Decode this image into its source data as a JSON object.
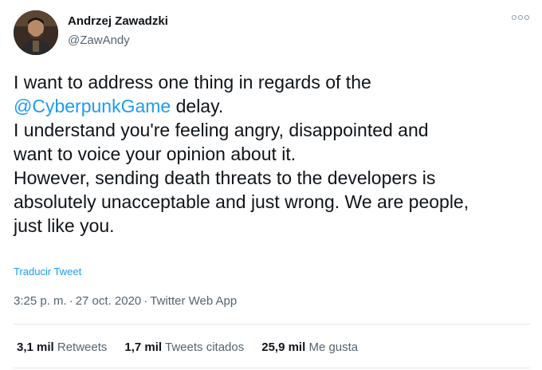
{
  "author": {
    "name": "Andrzej Zawadzki",
    "handle": "@ZawAndy"
  },
  "tweet": {
    "line1": "I want to address one thing in regards of the",
    "mention": "@CyberpunkGame",
    "line2_rest": " delay.",
    "line3": "I understand you're feeling angry, disappointed and",
    "line4": "want to voice your opinion about it.",
    "line5": "However, sending death threats to the developers is",
    "line6": "absolutely unacceptable and just wrong. We are people,",
    "line7": "just like you."
  },
  "translate_label": "Traducir Tweet",
  "meta": {
    "time": "3:25 p. m.",
    "date": "27 oct. 2020",
    "source": "Twitter Web App",
    "separator": "·"
  },
  "stats": {
    "retweets_count": "3,1 mil",
    "retweets_label": "Retweets",
    "quotes_count": "1,7 mil",
    "quotes_label": "Tweets citados",
    "likes_count": "25,9 mil",
    "likes_label": "Me gusta"
  },
  "colors": {
    "accent": "#1d9bf0",
    "text": "#0f1419",
    "secondary": "#536471",
    "divider": "#e1e8ed"
  },
  "icons": {
    "more": "more-horizontal-icon"
  }
}
